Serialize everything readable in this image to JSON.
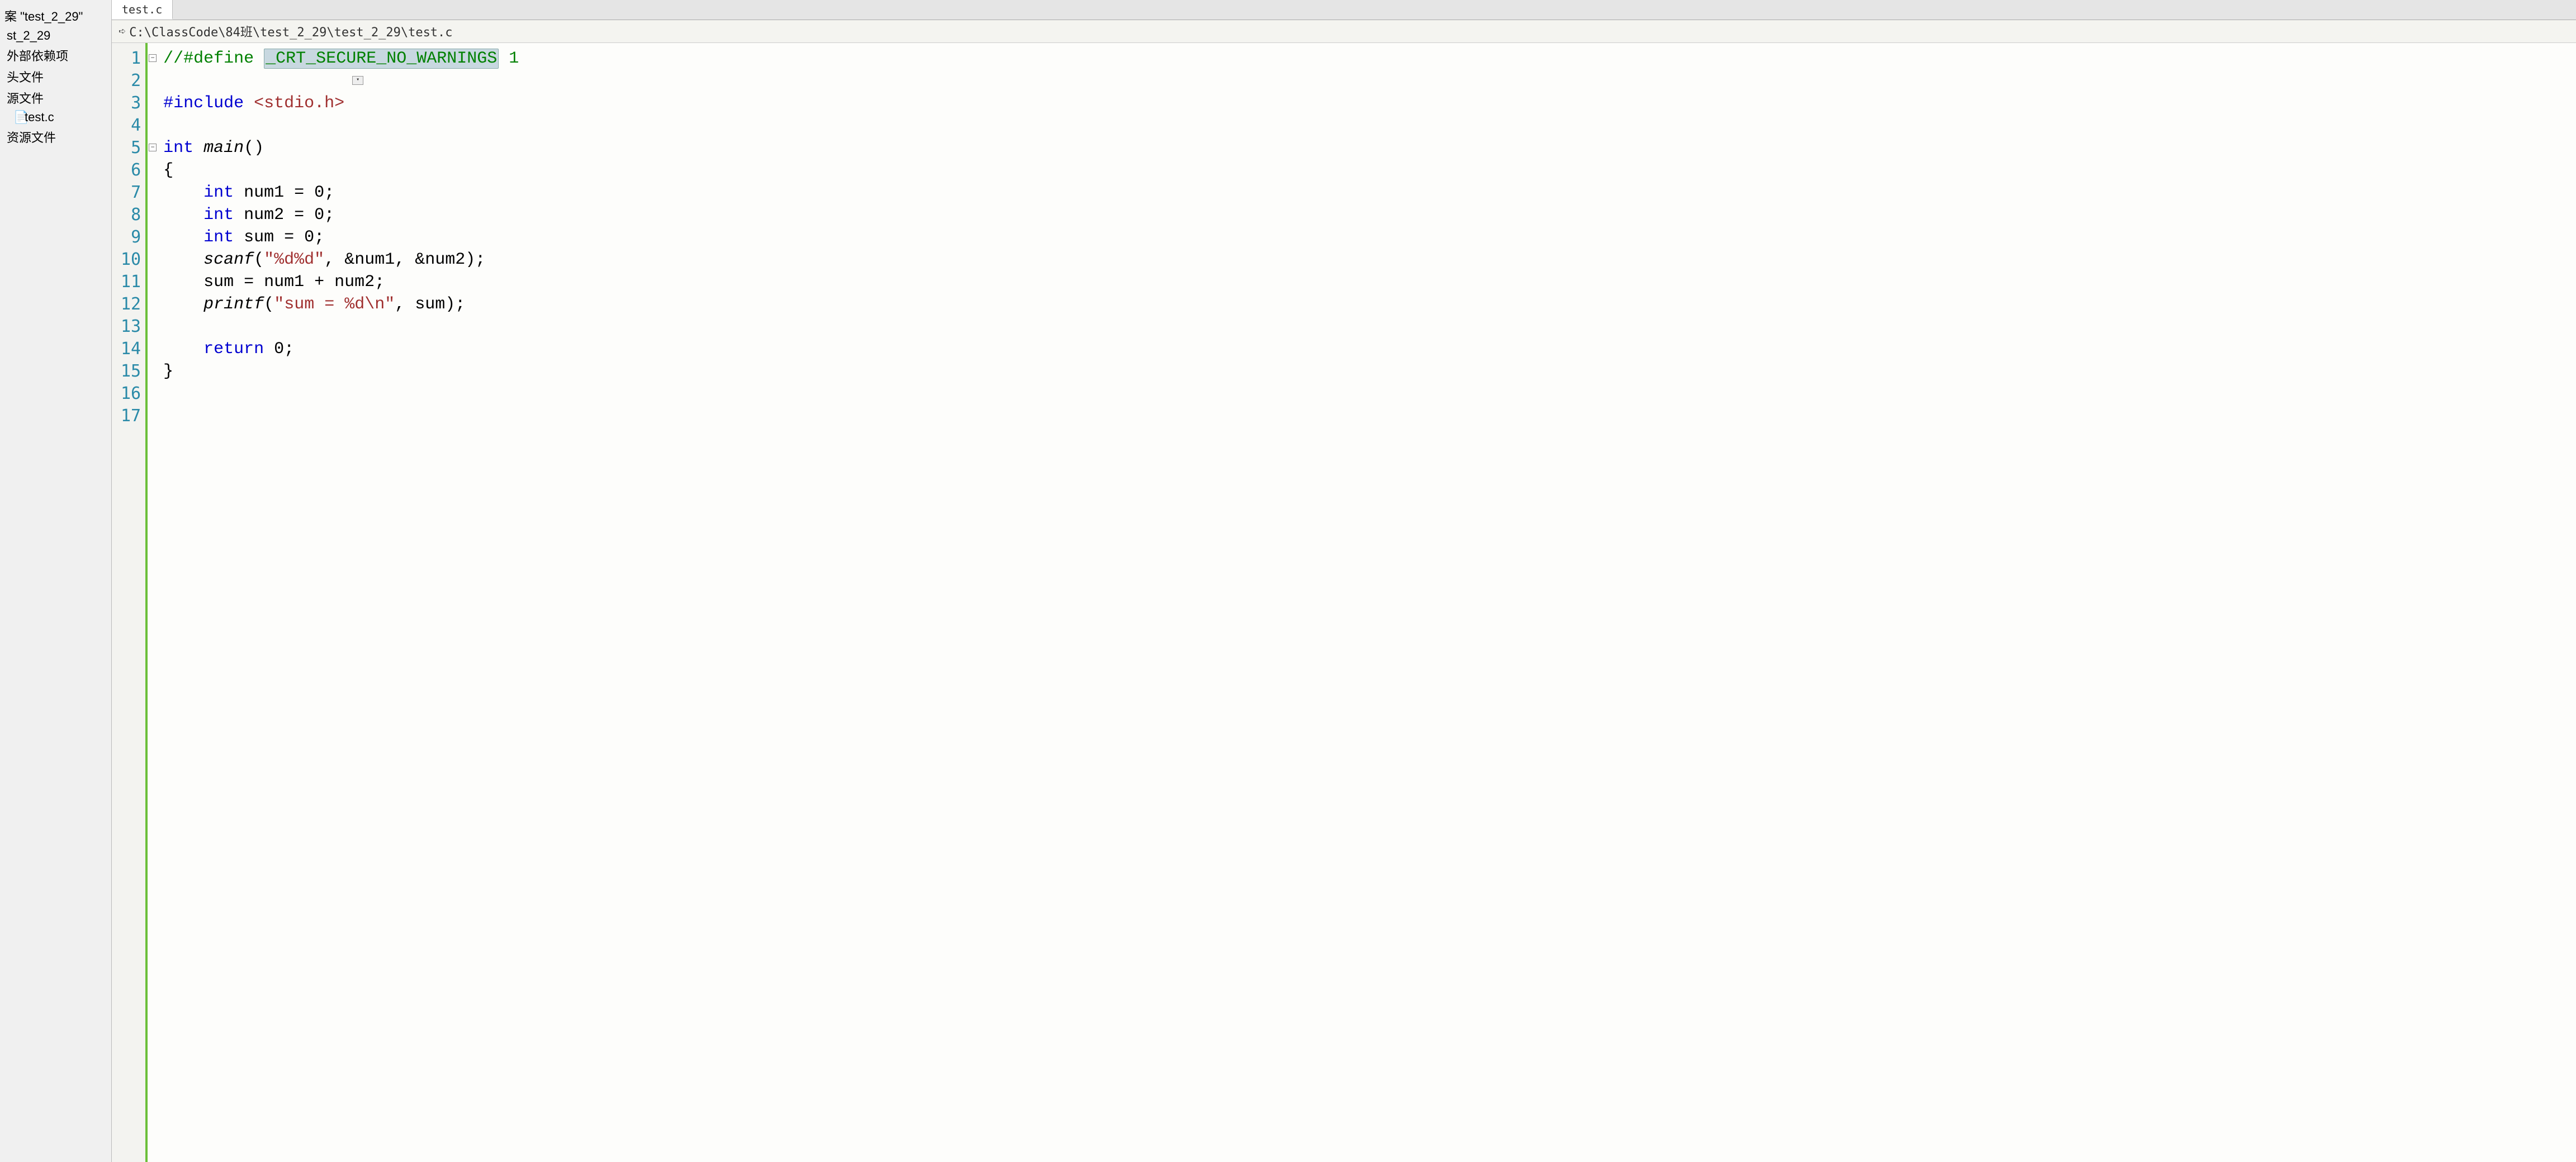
{
  "sidebar": {
    "search_label": "案 \"test_2_29\"",
    "items": [
      {
        "label": "st_2_29"
      },
      {
        "label": "外部依赖项"
      },
      {
        "label": "头文件"
      },
      {
        "label": "源文件"
      },
      {
        "label": "test.c",
        "icon": "📄"
      },
      {
        "label": "资源文件"
      }
    ]
  },
  "tabs": [
    {
      "label": "test.c",
      "active": true
    }
  ],
  "breadcrumb": {
    "icon": "➪",
    "path": "C:\\ClassCode\\84班\\test_2_29\\test_2_29\\test.c"
  },
  "editor": {
    "line_numbers": [
      "1",
      "2",
      "3",
      "4",
      "5",
      "6",
      "7",
      "8",
      "9",
      "10",
      "11",
      "12",
      "13",
      "14",
      "15",
      "16",
      "17"
    ],
    "fold_markers": [
      {
        "line": 1,
        "symbol": "▭"
      },
      {
        "line": 5,
        "symbol": "▭"
      }
    ],
    "code_lines": [
      {
        "tokens": [
          {
            "t": "//",
            "c": "kw-comment"
          },
          {
            "t": "#define ",
            "c": "kw-comment"
          },
          {
            "t": "_CRT_SECURE_NO_WARNINGS",
            "c": "kw-comment highlight-box"
          },
          {
            "t": " 1",
            "c": "kw-comment"
          }
        ]
      },
      {
        "tokens": [
          {
            "t": " ",
            "c": ""
          }
        ],
        "dropdown": true
      },
      {
        "tokens": [
          {
            "t": "#include ",
            "c": "kw-blue"
          },
          {
            "t": "<stdio.h>",
            "c": "kw-string"
          }
        ]
      },
      {
        "tokens": [
          {
            "t": " ",
            "c": ""
          }
        ]
      },
      {
        "tokens": [
          {
            "t": "int",
            "c": "kw-type"
          },
          {
            "t": " ",
            "c": ""
          },
          {
            "t": "main",
            "c": "kw-func"
          },
          {
            "t": "()",
            "c": ""
          }
        ]
      },
      {
        "tokens": [
          {
            "t": "{",
            "c": ""
          }
        ]
      },
      {
        "tokens": [
          {
            "t": "    ",
            "c": ""
          },
          {
            "t": "int",
            "c": "kw-type"
          },
          {
            "t": " num1 = 0;",
            "c": ""
          }
        ]
      },
      {
        "tokens": [
          {
            "t": "    ",
            "c": ""
          },
          {
            "t": "int",
            "c": "kw-type"
          },
          {
            "t": " num2 = 0;",
            "c": ""
          }
        ]
      },
      {
        "tokens": [
          {
            "t": "    ",
            "c": ""
          },
          {
            "t": "int",
            "c": "kw-type"
          },
          {
            "t": " sum = 0;",
            "c": ""
          }
        ]
      },
      {
        "tokens": [
          {
            "t": "    ",
            "c": ""
          },
          {
            "t": "scanf",
            "c": "kw-func"
          },
          {
            "t": "(",
            "c": ""
          },
          {
            "t": "\"%d%d\"",
            "c": "kw-string"
          },
          {
            "t": ", &num1, &num2);",
            "c": ""
          }
        ]
      },
      {
        "tokens": [
          {
            "t": "    sum = num1 + num2;",
            "c": ""
          }
        ]
      },
      {
        "tokens": [
          {
            "t": "    ",
            "c": ""
          },
          {
            "t": "printf",
            "c": "kw-func"
          },
          {
            "t": "(",
            "c": ""
          },
          {
            "t": "\"sum = %d\\n\"",
            "c": "kw-string"
          },
          {
            "t": ", sum);",
            "c": ""
          }
        ]
      },
      {
        "tokens": [
          {
            "t": " ",
            "c": ""
          }
        ]
      },
      {
        "tokens": [
          {
            "t": "    ",
            "c": ""
          },
          {
            "t": "return",
            "c": "kw-blue"
          },
          {
            "t": " 0;",
            "c": ""
          }
        ]
      },
      {
        "tokens": [
          {
            "t": "}",
            "c": ""
          }
        ]
      },
      {
        "tokens": [
          {
            "t": " ",
            "c": ""
          }
        ]
      },
      {
        "tokens": [
          {
            "t": " ",
            "c": ""
          }
        ]
      }
    ]
  }
}
